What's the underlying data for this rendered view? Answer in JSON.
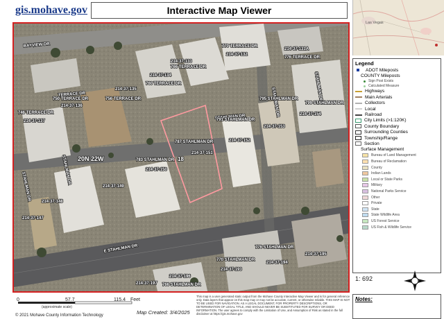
{
  "header": {
    "site": "gis.mohave.gov",
    "title": "Interactive Map Viewer"
  },
  "inset": {
    "city": "Las Vegas"
  },
  "map": {
    "township_label": "20N 22W",
    "section_number": "18",
    "streets": [
      "BAYVIEW DR",
      "TERRACE DR",
      "STAHLMAN DR",
      "STAHLMAN DR",
      "STAHLMAN DR",
      "E STAHLMAN DR",
      "STAHLMAN DR",
      "STAHLMAN DR"
    ],
    "parcels": [
      {
        "apn": "214-37-133",
        "addr": "766 TERRACE DR"
      },
      {
        "apn": "214-37-132",
        "addr": "770 TERRACE DR"
      },
      {
        "apn": "214-37-134",
        "addr": "760 TERRACE DR"
      },
      {
        "apn": "214-37-135",
        "addr": "756 TERRACE DR"
      },
      {
        "apn": "214-37-136",
        "addr": "750 TERRACE DR"
      },
      {
        "apn": "214-37-137",
        "addr": "746 TERRACE DR"
      },
      {
        "apn": "214-37-151",
        "addr": "787 STAHLMAN DR"
      },
      {
        "apn": "214-37-150",
        "addr": "783 STAHLMAN DR"
      },
      {
        "apn": "214-37-152",
        "addr": "791 STAHLMAN DR"
      },
      {
        "apn": "214-37-153",
        "addr": "795 STAHLMAN DR"
      },
      {
        "apn": "214-37-154",
        "addr": "799 STAHLMAN DR"
      },
      {
        "apn": "214-37-131A",
        "addr": "776 TERRACE DR"
      },
      {
        "apn": "214-37-149",
        "addr": ""
      },
      {
        "apn": "214-37-148",
        "addr": ""
      },
      {
        "apn": "214-37-147",
        "addr": ""
      },
      {
        "apn": "214-37-193",
        "addr": "770 STAHLMAN DR"
      },
      {
        "apn": "214-37-194",
        "addr": "776 STAHLMAN DR"
      },
      {
        "apn": "214-37-195",
        "addr": ""
      },
      {
        "apn": "214-37-196",
        "addr": "766 STAHLMAN DR"
      },
      {
        "apn": "214-37-197",
        "addr": ""
      }
    ]
  },
  "legend": {
    "title": "Legend",
    "items": [
      {
        "label": "ADOT Mileposts",
        "kind": "square",
        "color": "#1d3fa0"
      },
      {
        "label": "COUNTY Mileposts",
        "kind": "none",
        "color": ""
      },
      {
        "label": "Sign Post Exists",
        "kind": "subdot",
        "color": "#3a8a3a"
      },
      {
        "label": "Calculated Measure",
        "kind": "subdot",
        "color": "#9bd09b"
      },
      {
        "label": "Highways",
        "kind": "line",
        "color": "#c8a030"
      },
      {
        "label": "Main Arterials",
        "kind": "line",
        "color": "#a08060"
      },
      {
        "label": "Collectors",
        "kind": "line",
        "color": "#b0b0b0"
      },
      {
        "label": "Local",
        "kind": "line",
        "color": "#d0d0d0"
      },
      {
        "label": "Railroad",
        "kind": "line",
        "color": "#444444"
      },
      {
        "label": "City Limits (>1:120K)",
        "kind": "box",
        "color": "#3a9a70"
      },
      {
        "label": "County Boundary",
        "kind": "box",
        "color": "#555555"
      },
      {
        "label": "Surrounding Counties",
        "kind": "box",
        "color": "#333333"
      },
      {
        "label": "Township/Range",
        "kind": "box",
        "color": "#222222"
      },
      {
        "label": "Section",
        "kind": "box",
        "color": "#666666"
      },
      {
        "label": "Surface Management",
        "kind": "none",
        "color": ""
      }
    ],
    "surface": [
      {
        "label": "Bureau of Land Management",
        "color": "#f6e3a8"
      },
      {
        "label": "Bureau of Reclamation",
        "color": "#ffe0b0"
      },
      {
        "label": "County",
        "color": "#e8e0c0"
      },
      {
        "label": "Indian Lands",
        "color": "#f0c8a0"
      },
      {
        "label": "Local or State Parks",
        "color": "#c8e0a8"
      },
      {
        "label": "Military",
        "color": "#e8c8e8"
      },
      {
        "label": "National Parks Service",
        "color": "#d8c0e0"
      },
      {
        "label": "Other",
        "color": "#f0d8d8"
      },
      {
        "label": "Private",
        "color": "#ffffff"
      },
      {
        "label": "State",
        "color": "#d0e4f4"
      },
      {
        "label": "State Wildlife Area",
        "color": "#c0dcf0"
      },
      {
        "label": "US Forest Service",
        "color": "#c8e8c0"
      },
      {
        "label": "US Fish & Wildlife Service",
        "color": "#b8d8c8"
      }
    ]
  },
  "scale": {
    "ratio": "1: 692",
    "ticks": [
      "0",
      "57.7",
      "115.4"
    ],
    "unit": "Feet",
    "note": "(approximate scale)"
  },
  "footer": {
    "created": "Map Created: 3/4/2025",
    "copyright": "© 2021 Mohave County Information Technology",
    "disclaimer": "This map is a user generated static output from the Mohave County Interactive Map Viewer and is for general reference only. Data layers that appear on this map may or may not be accurate, current, or otherwise reliable. THIS MAP IS NOT TO BE USED FOR NAVIGATION. AS A LEGAL DOCUMENT, FOR PROPERTY DESCRIPTIONS, OR DETERMINATION OF LEGAL TITLE, AND SHOULD NEVER BE SUBSTITUTED FOR SURVEY OR DEED INFORMATION. The user agrees to comply with the Limitation of Use, and Assumption of Risk as stated in the full disclaimer at https://gis.mohave.gov"
  },
  "notes": {
    "label": "Notes:"
  }
}
